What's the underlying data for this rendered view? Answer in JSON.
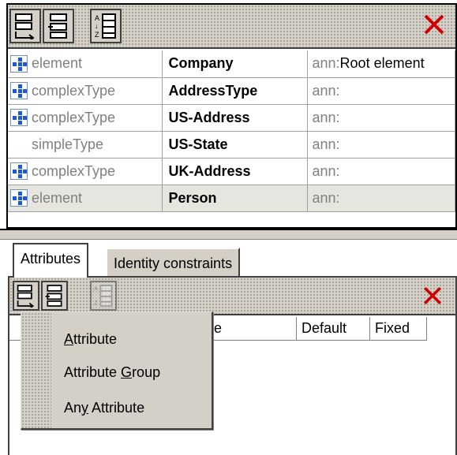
{
  "schema_rows": [
    {
      "kind": "element",
      "name": "Company",
      "ann_prefix": "ann:",
      "ann_text": "Root element",
      "icon": "element-icon",
      "selected": false
    },
    {
      "kind": "complexType",
      "name": "AddressType",
      "ann_prefix": "ann:",
      "ann_text": "",
      "icon": "element-icon",
      "selected": false
    },
    {
      "kind": "complexType",
      "name": "US-Address",
      "ann_prefix": "ann:",
      "ann_text": "",
      "icon": "element-icon",
      "selected": false
    },
    {
      "kind": "simpleType",
      "name": "US-State",
      "ann_prefix": "ann:",
      "ann_text": "",
      "icon": "",
      "selected": false
    },
    {
      "kind": "complexType",
      "name": "UK-Address",
      "ann_prefix": "ann:",
      "ann_text": "",
      "icon": "element-icon",
      "selected": false
    },
    {
      "kind": "element",
      "name": "Person",
      "ann_prefix": "ann:",
      "ann_text": "",
      "icon": "element-icon",
      "selected": true
    }
  ],
  "tabs": [
    {
      "label": "Attributes",
      "active": true
    },
    {
      "label": "Identity constraints",
      "active": false
    }
  ],
  "attr_columns": {
    "use_partial": "se",
    "default": "Default",
    "fixed": "Fixed"
  },
  "menu": {
    "items": [
      {
        "pre": "",
        "mnemonic": "A",
        "post": "ttribute"
      },
      {
        "pre": "Attribute ",
        "mnemonic": "G",
        "post": "roup"
      },
      {
        "pre": "An",
        "mnemonic": "y",
        "post": " Attribute"
      }
    ]
  },
  "colors": {
    "close_red": "#cc0000",
    "icon_blue": "#1d58d6",
    "face": "#d4d0c8"
  }
}
